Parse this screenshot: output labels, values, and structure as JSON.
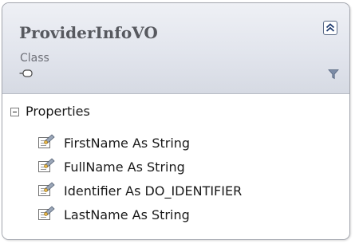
{
  "class_shape": {
    "name": "ProviderInfoVO",
    "stereotype": "Class",
    "collapse_icon": "double-chevron-up-icon",
    "interface_icon": "lollipop-icon",
    "filter_icon": "filter-icon"
  },
  "compartments": [
    {
      "title": "Properties",
      "expander_icon": "minus-box-icon",
      "member_icon": "property-icon",
      "members": [
        "FirstName As String",
        "FullName As String",
        "Identifier As DO_IDENTIFIER",
        "LastName As String"
      ]
    }
  ],
  "colors": {
    "header_gradient_top": "#eef0f5",
    "header_gradient_bottom": "#d6dae3",
    "border": "#a3a6ae",
    "class_name": "#57595f",
    "text": "#1a1a1a"
  }
}
